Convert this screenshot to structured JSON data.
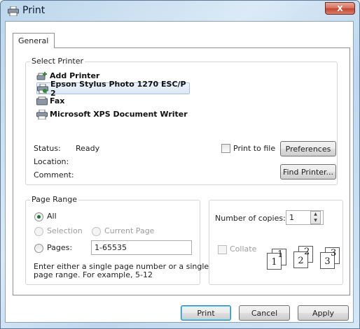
{
  "window": {
    "title": "Print",
    "close_label": "X"
  },
  "tabs": [
    {
      "label": "General"
    }
  ],
  "select_printer": {
    "legend": "Select Printer",
    "printers": [
      {
        "name": "Add Printer",
        "icon": "add-printer-icon",
        "selected": false
      },
      {
        "name": "Epson Stylus Photo 1270 ESC/P 2",
        "icon": "printer-icon",
        "selected": true
      },
      {
        "name": "Fax",
        "icon": "fax-icon",
        "selected": false
      },
      {
        "name": "Microsoft XPS Document Writer",
        "icon": "printer-icon",
        "selected": false
      }
    ],
    "status_label": "Status:",
    "status_value": "Ready",
    "location_label": "Location:",
    "comment_label": "Comment:",
    "print_to_file_label": "Print to file",
    "print_to_file_checked": false,
    "preferences_label": "Preferences",
    "find_printer_label": "Find Printer..."
  },
  "page_range": {
    "legend": "Page Range",
    "all_label": "All",
    "selection_label": "Selection",
    "current_page_label": "Current Page",
    "pages_label": "Pages:",
    "pages_value": "1-65535",
    "hint_line1": "Enter either a single page number or a single",
    "hint_line2": "page range.  For example, 5-12",
    "selected_option": "All"
  },
  "copies": {
    "number_label": "Number of copies:",
    "number_value": "1",
    "collate_label": "Collate",
    "collate_checked": false,
    "collate_pages": [
      "1",
      "1",
      "2",
      "2",
      "3",
      "3"
    ]
  },
  "buttons": {
    "print": "Print",
    "cancel": "Cancel",
    "apply": "Apply"
  },
  "colors": {
    "title_bar": "#bcd6ec",
    "close_button": "#c24430",
    "default_button_glow": "#48d3fb"
  }
}
